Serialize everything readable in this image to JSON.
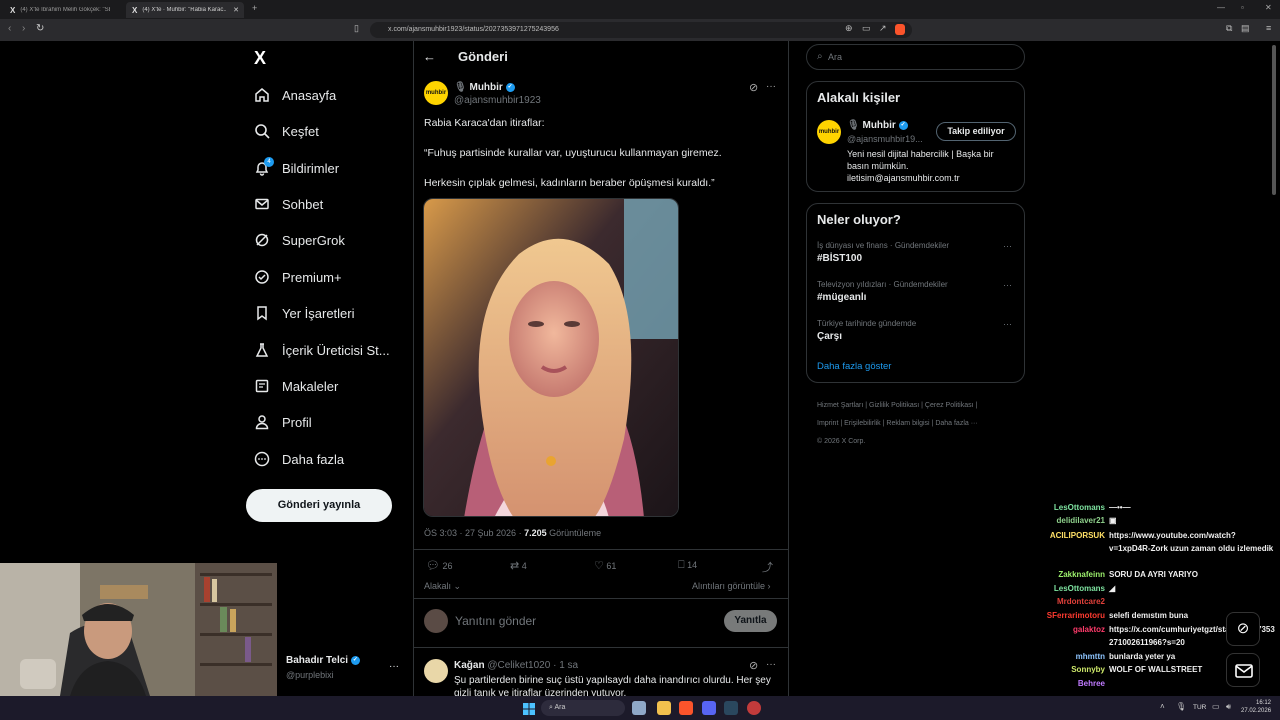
{
  "browser": {
    "tabs": [
      {
        "title": "(4) X'te İbrahim Melih Gökçek: \"SEZ..."
      },
      {
        "title": "(4) X'te ∙ Muhbir: \"Rabia Karac..."
      }
    ],
    "new_tab": "+",
    "url": "x.com/ajansmuhbir1923/status/2027353971275243956"
  },
  "sidebar": {
    "logo": "X",
    "items": [
      {
        "label": "Anasayfa",
        "icon": "home-icon"
      },
      {
        "label": "Keşfet",
        "icon": "search-icon"
      },
      {
        "label": "Bildirimler",
        "icon": "bell-icon",
        "badge": "4"
      },
      {
        "label": "Sohbet",
        "icon": "mail-icon"
      },
      {
        "label": "SuperGrok",
        "icon": "grok-icon"
      },
      {
        "label": "Premium+",
        "icon": "verified-icon"
      },
      {
        "label": "Yer İşaretleri",
        "icon": "bookmark-icon"
      },
      {
        "label": "İçerik Üreticisi St...",
        "icon": "flask-icon"
      },
      {
        "label": "Makaleler",
        "icon": "article-icon"
      },
      {
        "label": "Profil",
        "icon": "person-icon"
      },
      {
        "label": "Daha fazla",
        "icon": "more-circle-icon"
      }
    ],
    "post_button": "Gönderi yayınla",
    "account": {
      "name": "Bahadır Telci",
      "handle": "@purplebixi"
    }
  },
  "main": {
    "header": "Gönderi",
    "post": {
      "author_name": "Muhbir",
      "author_handle": "@ajansmuhbir1923",
      "avatar_text": "muhbir",
      "text1": "Rabia Karaca'dan itiraflar:",
      "text2": "“Fuhuş partisinde kurallar var, uyuşturucu kullanmayan giremez.",
      "text3": "Herkesin çıplak gelmesi, kadınların beraber öpüşmesi kuraldı.”",
      "time": "ÖS 3:03 · 27 Şub 2026 · ",
      "views": "7.205",
      "views_label": " Görüntüleme",
      "replies": "26",
      "reposts": "4",
      "likes": "61",
      "bookmarks": "14",
      "related": "Alakalı",
      "quotes": "Alıntıları görüntüle"
    },
    "reply_box": {
      "placeholder": "Yanıtını gönder",
      "button": "Yanıtla"
    },
    "reply": {
      "name": "Kağan",
      "handle": "@Celiket1020",
      "time": "· 1 sa",
      "text": "Şu partilerden birine suç üstü yapılsaydı daha inandırıcı olurdu. Her şey gizli tanık ve itiraflar üzerinden yutuyor."
    }
  },
  "right": {
    "search_placeholder": "Ara",
    "related_title": "Alakalı kişiler",
    "person": {
      "name": "Muhbir",
      "handle": "@ajansmuhbir19...",
      "follow": "Takip ediliyor",
      "bio": "Yeni nesil dijital habercilik | Başka bir basın mümkün. iletisim@ajansmuhbir.com.tr"
    },
    "trends_title": "Neler oluyor?",
    "trends": [
      {
        "category": "İş dünyası ve finans · Gündemdekiler",
        "tag": "#BİST100"
      },
      {
        "category": "Televizyon yıldızları · Gündemdekiler",
        "tag": "#mügeanlı"
      },
      {
        "category": "Türkiye tarihinde gündemde",
        "tag": "Çarşı"
      }
    ],
    "show_more": "Daha fazla göster",
    "footer": [
      "Hizmet Şartları",
      "Gizlilik Politikası",
      "Çerez Politikası",
      "Imprint",
      "Erişilebilirlik",
      "Reklam bilgisi",
      "Daha fazla ···",
      "© 2026 X Corp."
    ]
  },
  "chat": [
    {
      "name": "LesOttomans",
      "color": "#7ee3a0",
      "msg": "—••—"
    },
    {
      "name": "delidilaver21",
      "color": "#8fd18c",
      "msg": "▣"
    },
    {
      "name": "ACILIPORSUK",
      "color": "#ffe066",
      "msg": "https://www.youtube.com/watch?v=1xpD4R-Zork uzun zaman oldu izlemedik"
    },
    {
      "name": "Zakknafeinn",
      "color": "#9cf06c",
      "msg": "SORU DA AYRI YARIYO"
    },
    {
      "name": "LesOttomans",
      "color": "#7ee3a0",
      "msg": "◢"
    },
    {
      "name": "Mrdontcare2",
      "color": "#e0403a",
      "msg": ""
    },
    {
      "name": "SFerrarimotoru",
      "color": "#ff3b30",
      "msg": "selefi demıstım buna"
    },
    {
      "name": "galaktoz",
      "color": "#ff3b6b",
      "msg": "https://x.com/cumhuriyetgzt/status/2027353271002611966?s=20"
    },
    {
      "name": "mhmttn",
      "color": "#8ec5ff",
      "msg": "bunlarda yeter ya"
    },
    {
      "name": "Sonnyby",
      "color": "#cde86a",
      "msg": "WOLF OF WALLSTREET"
    },
    {
      "name": "Behree",
      "color": "#c07bff",
      "msg": ""
    }
  ],
  "taskbar": {
    "search": "Ara",
    "lang": "TUR",
    "time": "16:12",
    "date": "27.02.2026"
  }
}
